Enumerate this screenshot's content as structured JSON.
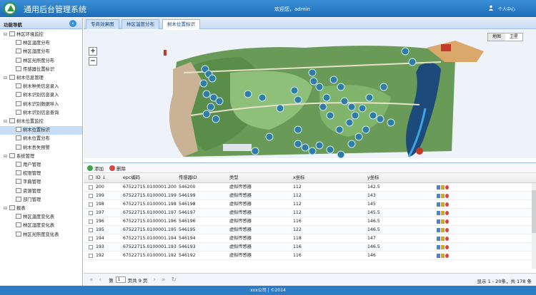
{
  "app": {
    "title": "通用后台管理系统",
    "welcome": "欢迎您，admin",
    "user_center": "个人中心"
  },
  "sidebar": {
    "title": "功能导航",
    "items": [
      {
        "label": "林区环境监控",
        "level": 0
      },
      {
        "label": "林区温度分布",
        "level": 1
      },
      {
        "label": "林区湿度分布",
        "level": 1
      },
      {
        "label": "林区光照度分布",
        "level": 1
      },
      {
        "label": "传感器位置标识",
        "level": 1
      },
      {
        "label": "树木信息管理",
        "level": 0
      },
      {
        "label": "树木种类信息录入",
        "level": 1
      },
      {
        "label": "树木识别信息录入",
        "level": 1
      },
      {
        "label": "树木识别数据导入",
        "level": 1
      },
      {
        "label": "树木识别信息查询",
        "level": 1
      },
      {
        "label": "树木位置监控",
        "level": 0
      },
      {
        "label": "树木位置标识",
        "level": 1,
        "selected": true
      },
      {
        "label": "树木位置分布",
        "level": 1
      },
      {
        "label": "树木丢失预警",
        "level": 1
      },
      {
        "label": "系统管理",
        "level": 0
      },
      {
        "label": "用户管理",
        "level": 1
      },
      {
        "label": "权限管理",
        "level": 1
      },
      {
        "label": "字典管理",
        "level": 1
      },
      {
        "label": "资源管理",
        "level": 1
      },
      {
        "label": "部门管理",
        "level": 1
      },
      {
        "label": "报表",
        "level": 0
      },
      {
        "label": "林区温度变化表",
        "level": 1
      },
      {
        "label": "林区湿度变化表",
        "level": 1
      },
      {
        "label": "林区光照度变化表",
        "level": 1
      }
    ]
  },
  "tabs": [
    {
      "label": "专商效果图",
      "active": false
    },
    {
      "label": "林区温度分布",
      "active": false
    },
    {
      "label": "树木位置标识",
      "active": true
    }
  ],
  "map": {
    "zoom_in": "+",
    "zoom_out": "−",
    "type_map": "地图",
    "type_satellite": "卫星"
  },
  "grid": {
    "toolbar": {
      "add": "添加",
      "delete": "删除"
    },
    "columns": [
      "ID ↓",
      "epc编码",
      "传感器ID",
      "类型",
      "x坐标",
      "y坐标"
    ],
    "rows": [
      [
        "200",
        "67522715.0100001.200",
        "546200",
        "虚拟传感器",
        "112",
        "142.5"
      ],
      [
        "199",
        "67522715.0100001.199",
        "546199",
        "虚拟传感器",
        "112",
        "143"
      ],
      [
        "198",
        "67522715.0100001.198",
        "546198",
        "虚拟传感器",
        "112",
        "145"
      ],
      [
        "197",
        "67522715.0100001.197",
        "546197",
        "虚拟传感器",
        "112",
        "145.5"
      ],
      [
        "196",
        "67522715.0100001.196",
        "546196",
        "虚拟传感器",
        "116",
        "146.5"
      ],
      [
        "195",
        "67522715.0100001.195",
        "546195",
        "虚拟传感器",
        "122",
        "146.5"
      ],
      [
        "194",
        "67522715.0100001.194",
        "546194",
        "虚拟传感器",
        "118",
        "147"
      ],
      [
        "193",
        "67522715.0100001.193",
        "546193",
        "虚拟传感器",
        "116",
        "146.5"
      ],
      [
        "192",
        "67522715.0100001.192",
        "546192",
        "虚拟传感器",
        "116",
        "146"
      ]
    ]
  },
  "pager": {
    "page_label": "第",
    "page": "1",
    "of_pages": "页共 9 页",
    "info": "显示 1 - 20条，共 178 条"
  },
  "footer": "xxx公司 | ©2014"
}
